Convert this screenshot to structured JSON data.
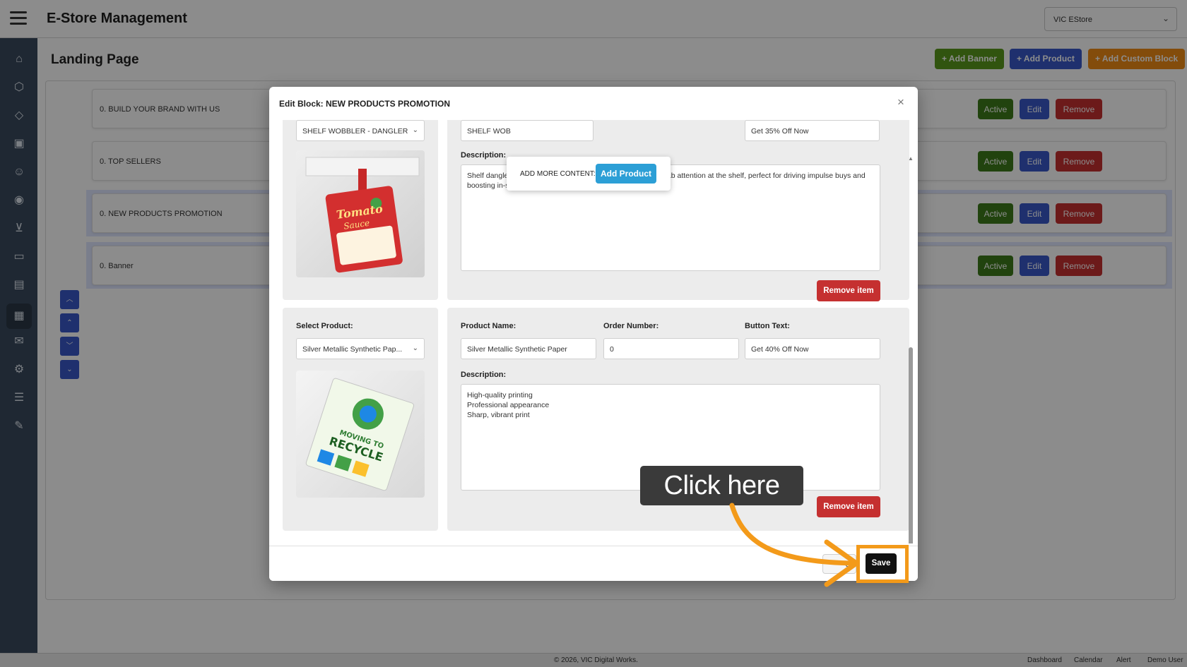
{
  "app": {
    "title": "E-Store Management",
    "store_selector": "VIC EStore"
  },
  "page": {
    "title": "Landing Page",
    "buttons": {
      "add_banner": "+ Add Banner",
      "add_product": "+ Add Product",
      "add_custom_block": "+ Add Custom Block"
    }
  },
  "sidebar": {
    "icons": [
      "home-icon",
      "box-icon",
      "tag-icon",
      "image-icon",
      "users-icon",
      "location-icon",
      "cart-icon",
      "truck-icon",
      "document-icon",
      "dashboard-icon",
      "mail-icon",
      "gear-icon",
      "sliders-icon",
      "wrench-icon"
    ],
    "active_index": 9
  },
  "blocks": [
    {
      "label": "0. BUILD YOUR BRAND WITH US",
      "active": "Active",
      "edit": "Edit",
      "remove": "Remove"
    },
    {
      "label": "0. TOP SELLERS",
      "active": "Active",
      "edit": "Edit",
      "remove": "Remove"
    },
    {
      "label": "0. NEW PRODUCTS PROMOTION",
      "active": "Active",
      "edit": "Edit",
      "remove": "Remove"
    },
    {
      "label": "0. Banner",
      "active": "Active",
      "edit": "Edit",
      "remove": "Remove"
    }
  ],
  "move_buttons": [
    "chevron-up-icon",
    "double-chevron-up-icon",
    "chevron-down-icon",
    "double-chevron-down-icon"
  ],
  "modal": {
    "title": "Edit Block: NEW PRODUCTS PROMOTION",
    "close": "×",
    "popup": {
      "label": "ADD MORE CONTENT:",
      "button": "Add Product"
    },
    "item1": {
      "select_value": "SHELF WOBBLER - DANGLER",
      "product_name": "SHELF WOB",
      "button_text": "Get 35% Off Now",
      "description_label": "Description:",
      "description": "Shelf danglers are lightweight, affordable, and designed to grab attention at the shelf, perfect for driving impulse buys and boosting in-store product visibility.",
      "remove": "Remove item",
      "image_text": [
        "Tomato",
        "Sauce"
      ]
    },
    "item2": {
      "select_label": "Select Product:",
      "select_value": "Silver Metallic Synthetic Pap...",
      "product_name_label": "Product Name:",
      "product_name": "Silver Metallic Synthetic Paper",
      "order_label": "Order Number:",
      "order_number": "0",
      "button_text_label": "Button Text:",
      "button_text": "Get 40% Off Now",
      "description_label": "Description:",
      "description": "High-quality printing\nProfessional appearance\nSharp, vibrant print",
      "remove": "Remove item",
      "image_text": [
        "MOVING TO",
        "RECYCLE"
      ]
    },
    "footer": {
      "cancel": "el",
      "save": "Save"
    }
  },
  "tutorial": {
    "tooltip": "Click here",
    "accent": "#f39a1a"
  },
  "footer": {
    "copyright": "© 2026, VIC Digital Works.",
    "links": [
      "Dashboard",
      "Calendar",
      "Alert",
      "Demo User"
    ]
  }
}
